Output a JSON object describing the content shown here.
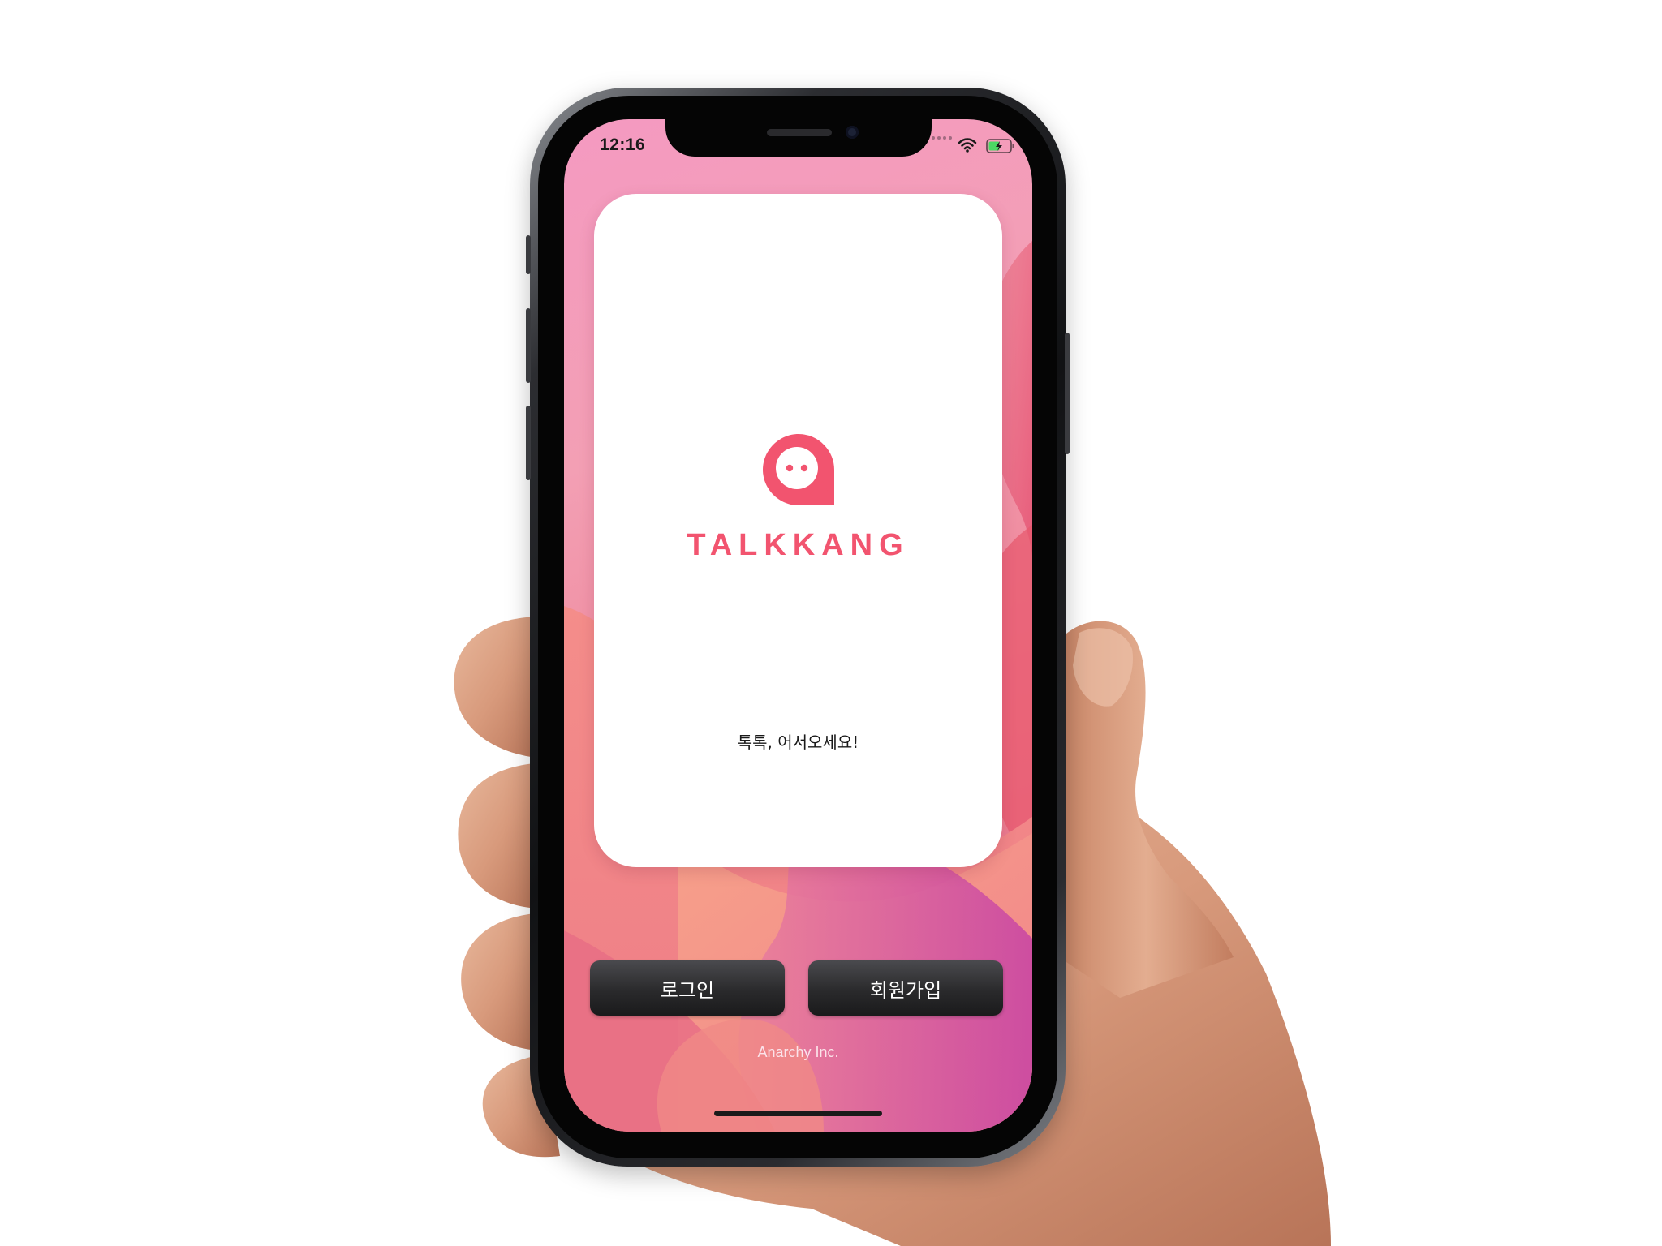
{
  "status_bar": {
    "time": "12:16",
    "wifi_icon": "wifi-icon",
    "battery_icon": "battery-charging-icon",
    "signal_icon": "signal-dots-icon"
  },
  "card": {
    "logo_icon": "talkkang-logo-icon",
    "brand_name": "TALKKANG",
    "welcome_text": "톡톡, 어서오세요!"
  },
  "buttons": {
    "login_label": "로그인",
    "signup_label": "회원가입"
  },
  "footer": {
    "company": "Anarchy Inc."
  },
  "colors": {
    "brand_pink": "#f2546f",
    "background_gradient_start": "#f49ac1",
    "background_gradient_end": "#e66d83",
    "button_dark": "#2a2a2c"
  }
}
